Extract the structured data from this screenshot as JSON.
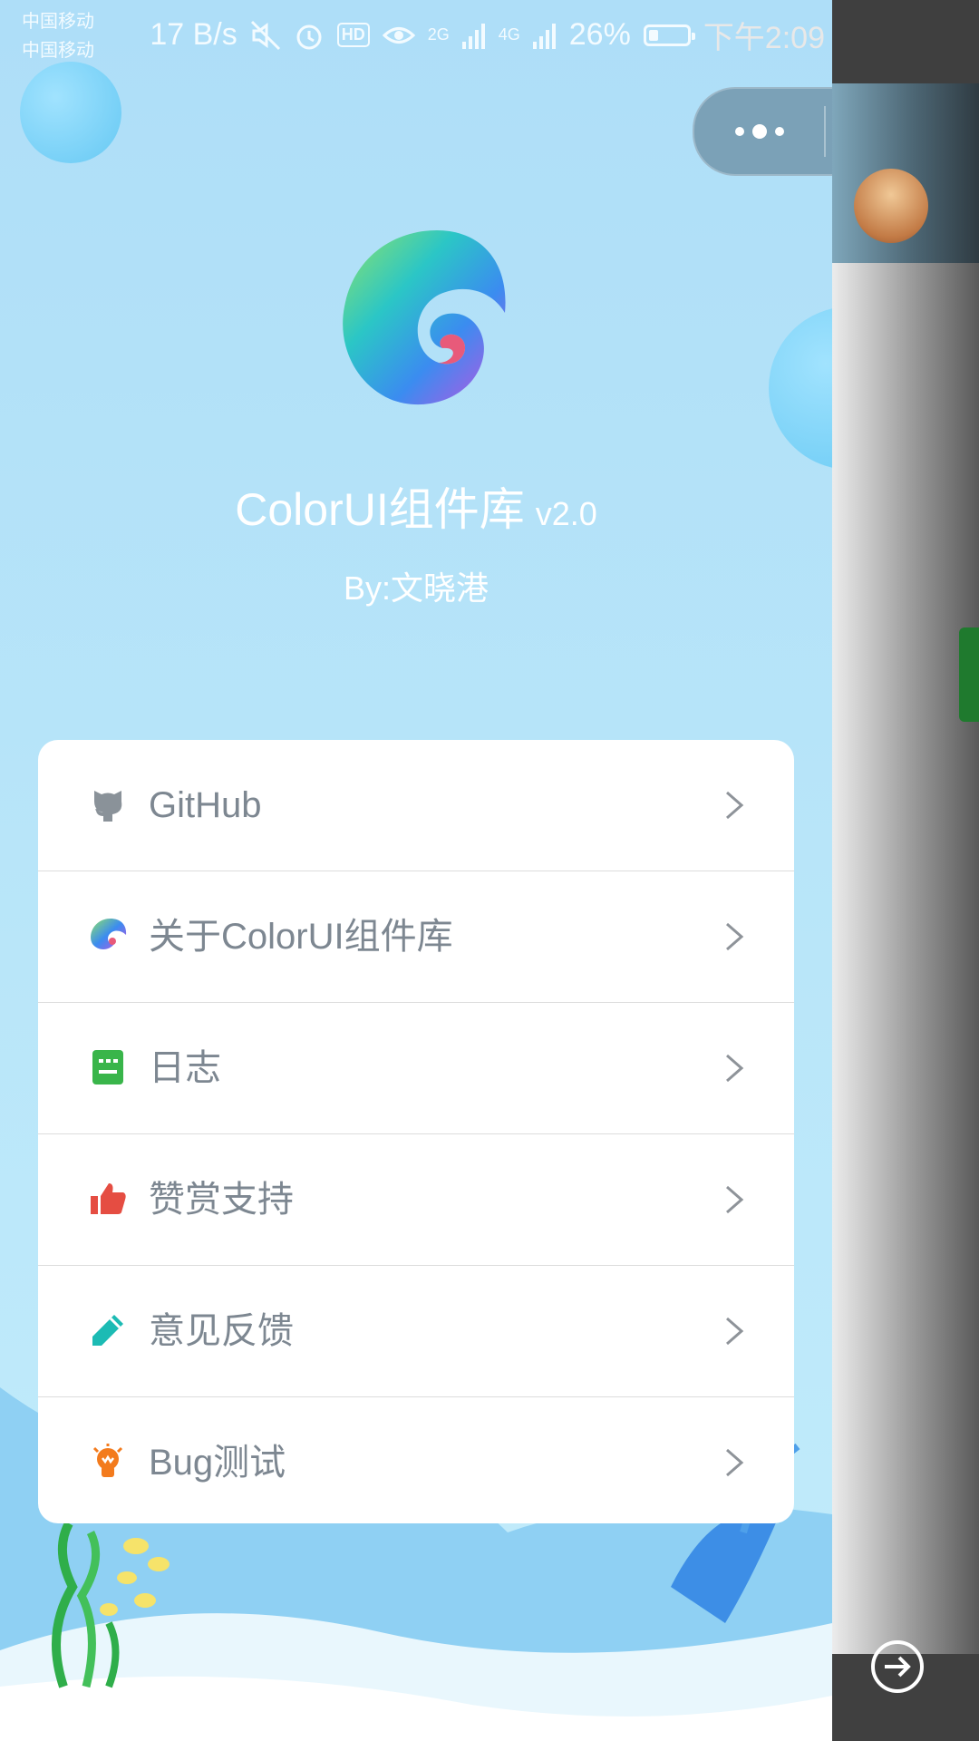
{
  "status_bar": {
    "carrier_1": "中国移动",
    "carrier_2": "中国移动",
    "net_speed": "17 B/s",
    "hd_badge": "HD",
    "signal_2g": "2G",
    "signal_4g": "4G",
    "battery": "26%",
    "battery_level": 0.26,
    "time": "下午2:09"
  },
  "header": {
    "app_name": "ColorUI组件库",
    "version": "v2.0",
    "author": "By:文晓港"
  },
  "menu": [
    {
      "label": "GitHub",
      "icon": "github-icon",
      "color": "#8a9299"
    },
    {
      "label": "关于ColorUI组件库",
      "icon": "colorui-logo-icon",
      "color": "#3aa0f0"
    },
    {
      "label": "日志",
      "icon": "log-icon",
      "color": "#39b54a"
    },
    {
      "label": "赞赏支持",
      "icon": "thumbs-up-icon",
      "color": "#e54d42"
    },
    {
      "label": "意见反馈",
      "icon": "pencil-icon",
      "color": "#1cbbb4"
    },
    {
      "label": "Bug测试",
      "icon": "bug-icon",
      "color": "#f37b1d"
    }
  ]
}
